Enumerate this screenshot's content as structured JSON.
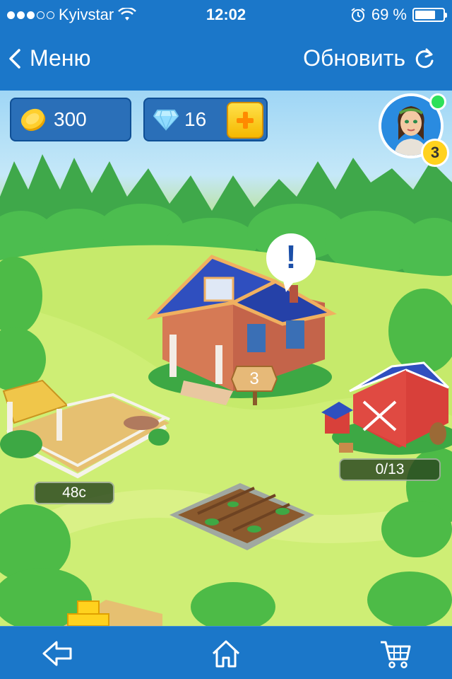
{
  "status_bar": {
    "carrier": "Kyivstar",
    "time": "12:02",
    "battery": "69 %",
    "signal_icon": "signal-dots-icon",
    "wifi_icon": "wifi-icon",
    "alarm_icon": "alarm-icon",
    "battery_level": 0.69
  },
  "nav": {
    "back_label": "Меню",
    "refresh_label": "Обновить"
  },
  "resources": {
    "coins": "300",
    "gems": "16",
    "plus_icon": "plus-icon"
  },
  "player": {
    "level": "3",
    "online": true,
    "online_color": "#2ee05a"
  },
  "buildings": {
    "house_level": "3",
    "house_alert": "!",
    "barn_storage": "0/13",
    "pen_timer": "48с"
  },
  "tab_bar": {
    "back_icon": "back-arrow-icon",
    "home_icon": "home-icon",
    "cart_icon": "cart-icon"
  },
  "colors": {
    "bar_blue": "#1b77c9",
    "grass": "#c9ec6e",
    "roof_blue": "#2f4fbf",
    "barn_red": "#d8403a"
  }
}
